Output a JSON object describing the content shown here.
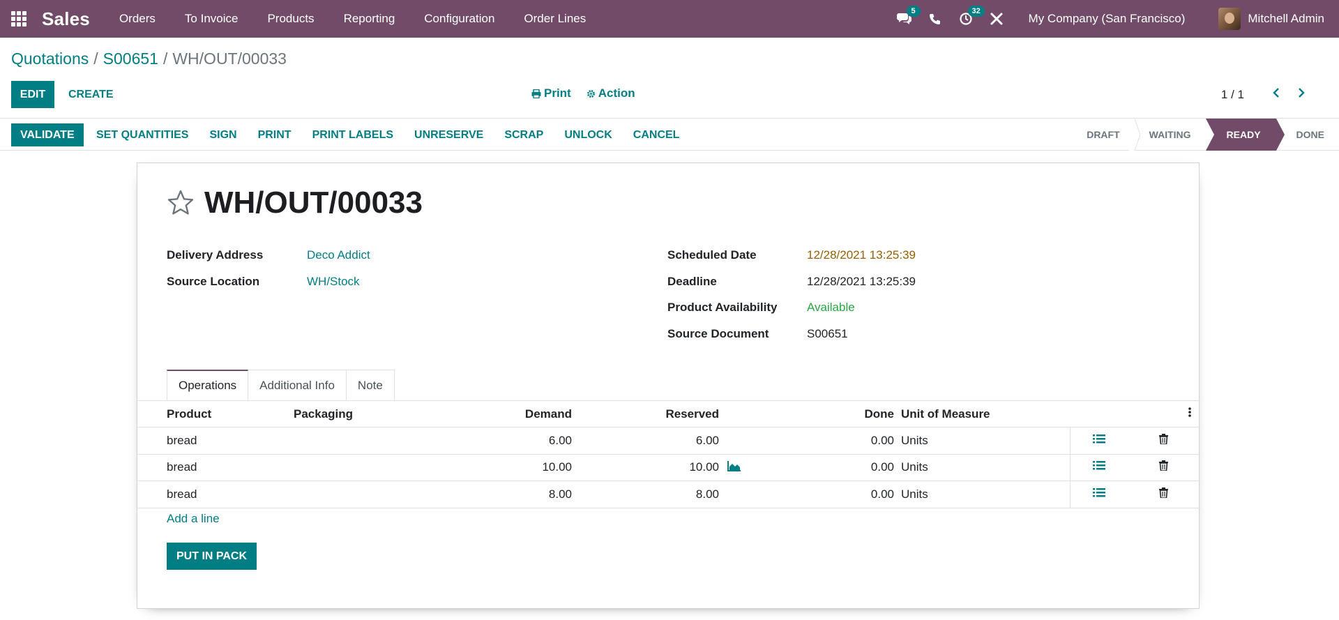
{
  "navbar": {
    "app_name": "Sales",
    "menu": [
      "Orders",
      "To Invoice",
      "Products",
      "Reporting",
      "Configuration",
      "Order Lines"
    ],
    "messages_count": "5",
    "activities_count": "32",
    "company": "My Company (San Francisco)",
    "user": "Mitchell Admin",
    "bg_color": "#714B67"
  },
  "breadcrumb": {
    "items": [
      "Quotations",
      "S00651"
    ],
    "current": "WH/OUT/00033",
    "separator": "/"
  },
  "control": {
    "edit_label": "Edit",
    "create_label": "Create",
    "print_label": "Print",
    "action_label": "Action",
    "pager": "1 / 1"
  },
  "header": {
    "validate_label": "Validate",
    "buttons": [
      "Set Quantities",
      "Sign",
      "Print",
      "Print Labels",
      "Unreserve",
      "Scrap",
      "Unlock",
      "Cancel"
    ],
    "stages": [
      "Draft",
      "Waiting",
      "Ready",
      "Done"
    ],
    "active_stage": "Ready"
  },
  "record": {
    "title": "WH/OUT/00033",
    "left_fields": [
      {
        "label": "Delivery Address",
        "value": "Deco Addict"
      },
      {
        "label": "Source Location",
        "value": "WH/Stock"
      }
    ],
    "right_fields": [
      {
        "label": "Scheduled Date",
        "value": "12/28/2021 13:25:39"
      },
      {
        "label": "Deadline",
        "value": "12/28/2021 13:25:39"
      },
      {
        "label": "Product Availability",
        "value": "Available"
      },
      {
        "label": "Source Document",
        "value": "S00651"
      }
    ]
  },
  "tabs": [
    "Operations",
    "Additional Info",
    "Note"
  ],
  "operations": {
    "columns": {
      "product": "Product",
      "packaging": "Packaging",
      "demand": "Demand",
      "reserved": "Reserved",
      "done": "Done",
      "uom": "Unit of Measure"
    },
    "rows": [
      {
        "product": "bread",
        "packaging": "",
        "demand": "6.00",
        "reserved": "6.00",
        "done": "0.00",
        "uom": "Units"
      },
      {
        "product": "bread",
        "packaging": "",
        "demand": "10.00",
        "reserved": "10.00",
        "done": "0.00",
        "uom": "Units"
      },
      {
        "product": "bread",
        "packaging": "",
        "demand": "8.00",
        "reserved": "8.00",
        "done": "0.00",
        "uom": "Units"
      }
    ],
    "add_line": "Add a line"
  },
  "footer": {
    "put_in_pack": "Put in Pack"
  },
  "colors": {
    "primary": "#017e84",
    "brand": "#714B67",
    "warning": "#966100",
    "success": "#28a745"
  }
}
